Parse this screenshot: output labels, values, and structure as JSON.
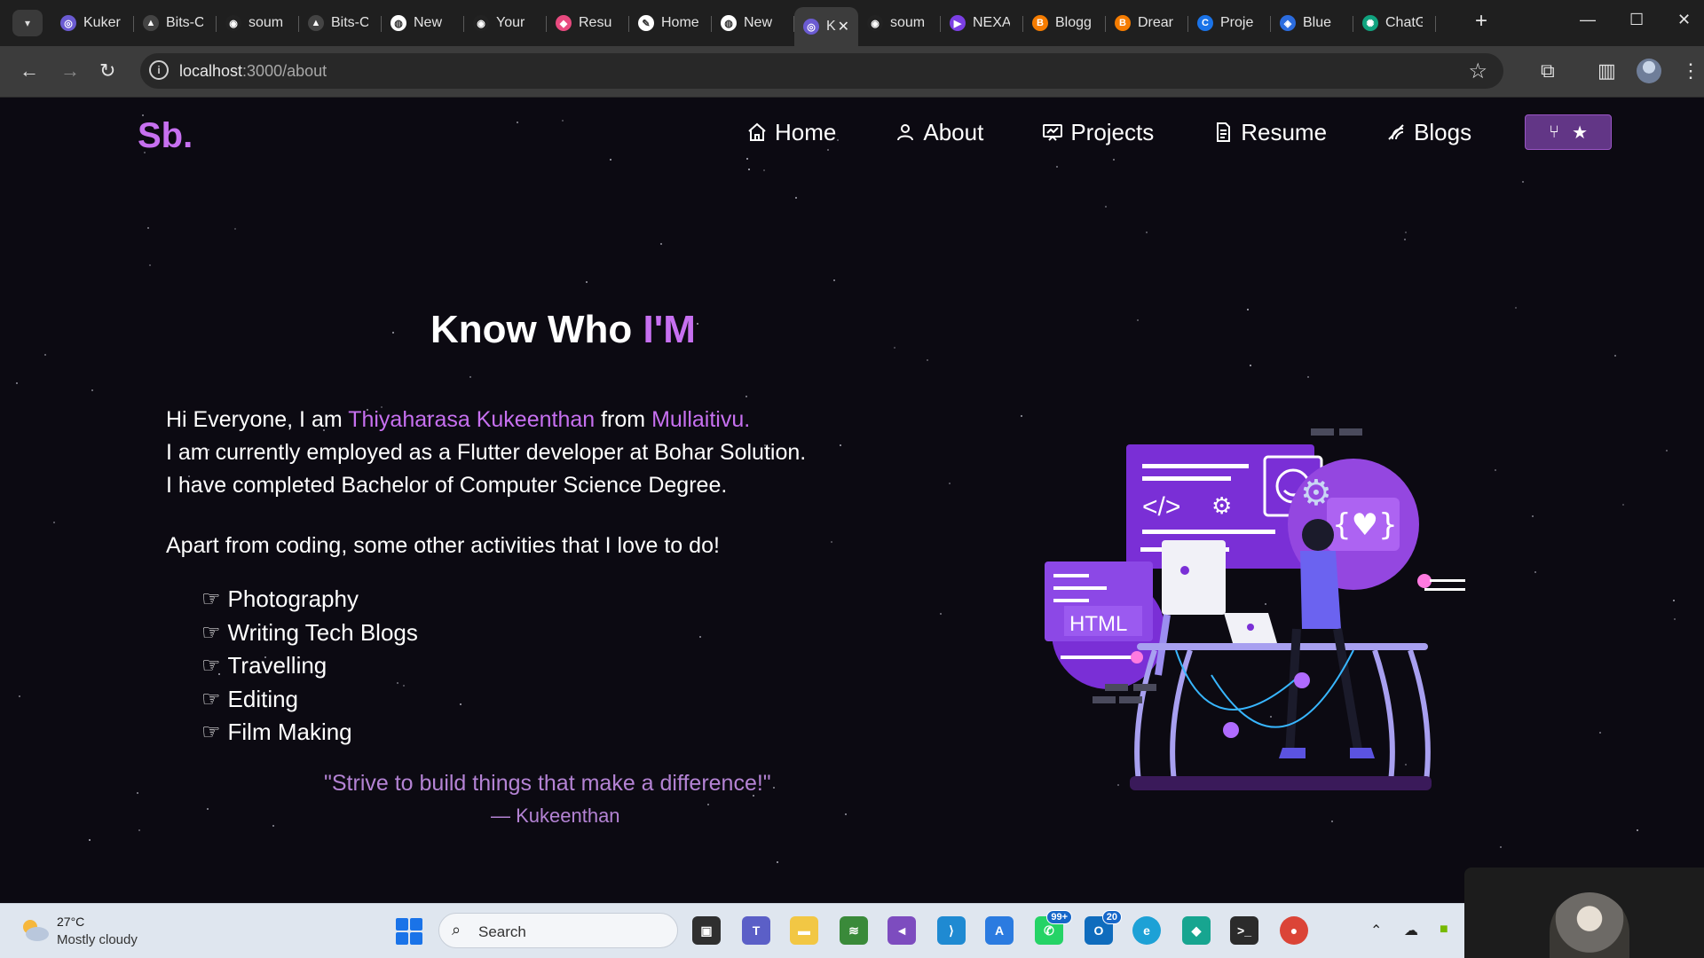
{
  "browser": {
    "tabs": [
      {
        "title": "Kuker",
        "favicon_color": "#6b5bd2",
        "icon": "circle-logo-icon"
      },
      {
        "title": "Bits-C",
        "favicon_color": "#444444",
        "icon": "triangle-logo-icon"
      },
      {
        "title": "soum",
        "favicon_color": "#222222",
        "icon": "github-icon"
      },
      {
        "title": "Bits-C",
        "favicon_color": "#444444",
        "icon": "triangle-logo-icon"
      },
      {
        "title": "New",
        "favicon_color": "#ffffff",
        "icon": "chrome-icon"
      },
      {
        "title": "Your",
        "favicon_color": "#222222",
        "icon": "github-icon"
      },
      {
        "title": "Resu",
        "favicon_color": "#e84a7f",
        "icon": "resume-icon"
      },
      {
        "title": "Home",
        "favicon_color": "#ffffff",
        "icon": "feather-icon"
      },
      {
        "title": "New",
        "favicon_color": "#ffffff",
        "icon": "chrome-icon"
      },
      {
        "title": "K",
        "favicon_color": "#6b5bd2",
        "icon": "circle-logo-icon",
        "active": true
      },
      {
        "title": "soum",
        "favicon_color": "#222222",
        "icon": "github-icon"
      },
      {
        "title": "NEXA",
        "favicon_color": "#7b3fe4",
        "icon": "play-icon"
      },
      {
        "title": "Blogg",
        "favicon_color": "#f57c00",
        "icon": "blogger-icon"
      },
      {
        "title": "Drear",
        "favicon_color": "#f57c00",
        "icon": "blogger-icon"
      },
      {
        "title": "Proje",
        "favicon_color": "#1a73e8",
        "icon": "c-logo-icon"
      },
      {
        "title": "Blue",
        "favicon_color": "#2b6cdf",
        "icon": "shield-icon"
      },
      {
        "title": "ChatG",
        "favicon_color": "#10a37f",
        "icon": "chatgpt-icon"
      }
    ],
    "url_host": "localhost",
    "url_path": ":3000/about"
  },
  "site": {
    "logo": "Sb.",
    "nav": [
      {
        "label": "Home",
        "icon": "home-icon"
      },
      {
        "label": "About",
        "icon": "user-icon"
      },
      {
        "label": "Projects",
        "icon": "projects-icon"
      },
      {
        "label": "Resume",
        "icon": "document-icon"
      },
      {
        "label": "Blogs",
        "icon": "blog-icon"
      }
    ],
    "fork_icons": [
      "git-fork-icon",
      "star-icon"
    ],
    "accent": "#c770f0"
  },
  "about": {
    "heading_plain": "Know Who ",
    "heading_accent": "I'M",
    "intro": {
      "line1_pre": "Hi Everyone, I am ",
      "name": "Thiyaharasa Kukeenthan",
      "line1_mid": " from ",
      "place": "Mullaitivu.",
      "line2": "I am currently employed as a Flutter developer at Bohar Solution.",
      "line3": "I have completed Bachelor of Computer Science Degree."
    },
    "activities_lead": "Apart from coding, some other activities that I love to do!",
    "activities": [
      "Photography",
      "Writing Tech Blogs",
      "Travelling",
      "Editing",
      "Film Making"
    ],
    "quote": "\"Strive to build things that make a difference!\"",
    "author": "— Kukeenthan",
    "illustration": {
      "html_label": "HTML",
      "code_label": "</>",
      "braces_label": "{♥}"
    }
  },
  "taskbar": {
    "weather_temp": "27°C",
    "weather_desc": "Mostly cloudy",
    "search_label": "Search",
    "badges": {
      "whatsapp": "99+",
      "outlook": "20"
    }
  }
}
